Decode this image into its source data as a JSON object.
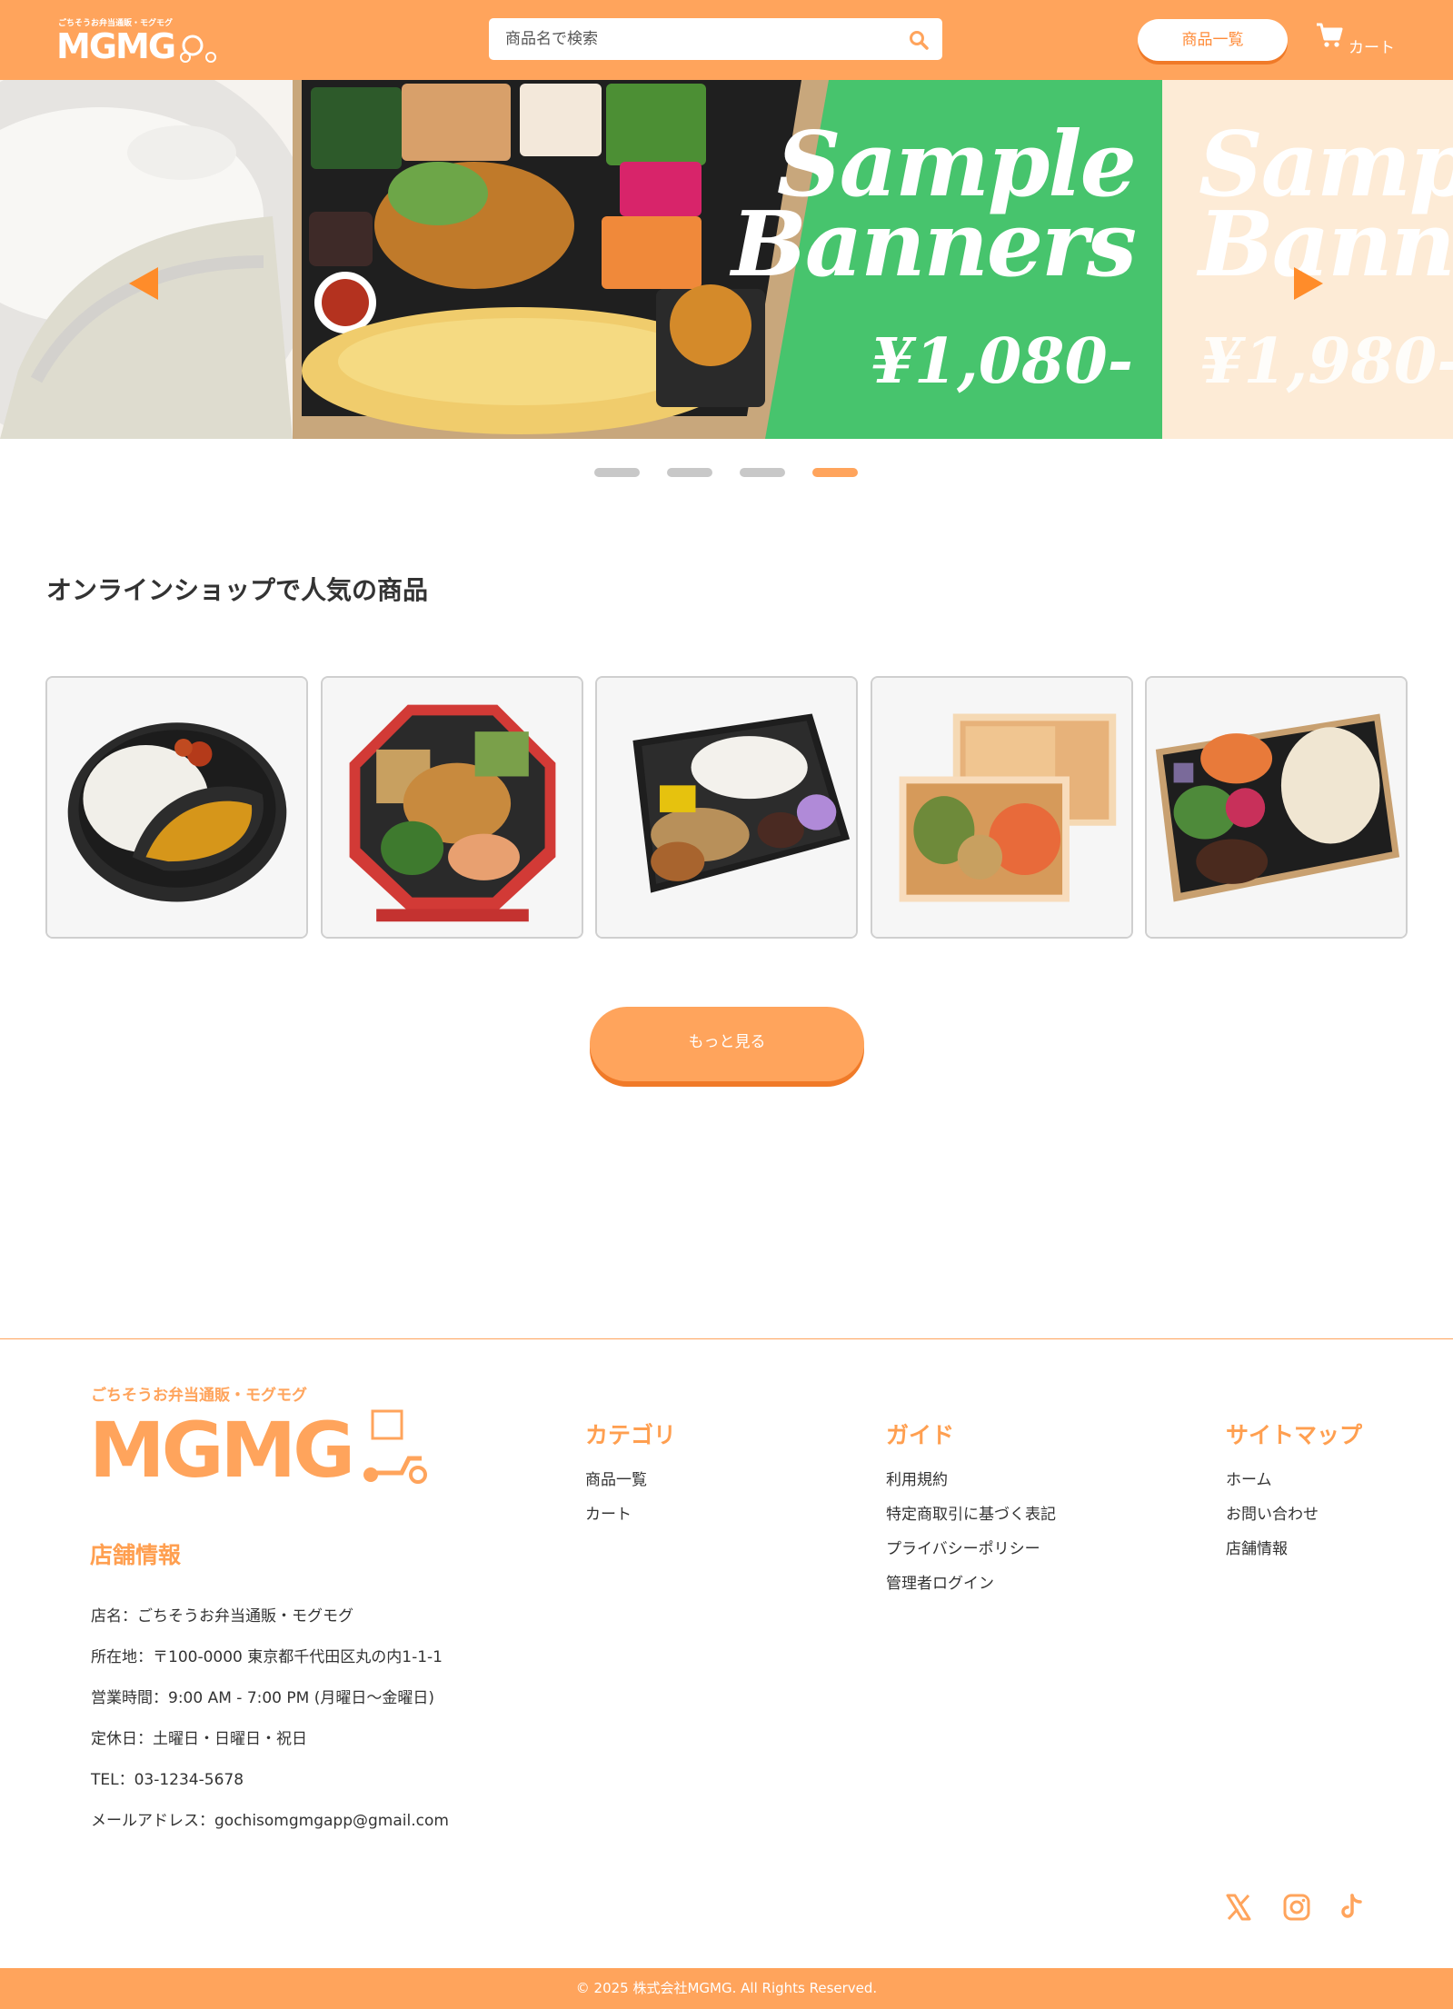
{
  "header": {
    "logo_tagline": "ごちそうお弁当通販・モグモグ",
    "logo_text": "MGMG",
    "search_placeholder": "商品名で検索",
    "products_button": "商品一覧",
    "cart_label": "カート",
    "icons": {
      "search": "search-icon",
      "cart": "cart-icon"
    }
  },
  "banner": {
    "main": {
      "title_line1": "Sample",
      "title_line2": "Banners",
      "price": "¥1,080-"
    },
    "next": {
      "title_line1": "Samp",
      "title_line2": "Banne",
      "price": "¥1,980-"
    },
    "slide_count": 4,
    "active_slide": 4
  },
  "popular": {
    "title": "オンラインショップで人気の商品",
    "products": [
      {
        "image": "curry-bento"
      },
      {
        "image": "octagon-bento"
      },
      {
        "image": "fish-bento"
      },
      {
        "image": "two-box-bento"
      },
      {
        "image": "rice-bento"
      }
    ],
    "more_button": "もっと見る"
  },
  "footer": {
    "logo_tagline": "ごちそうお弁当通販・モグモグ",
    "logo_text": "MGMG",
    "store": {
      "title": "店舗情報",
      "lines": [
        "店名：ごちそうお弁当通販・モグモグ",
        "所在地：〒100-0000 東京都千代田区丸の内1-1-1",
        "営業時間：9:00 AM - 7:00 PM (月曜日〜金曜日)",
        "定休日：土曜日・日曜日・祝日",
        "TEL：03-1234-5678",
        "メールアドレス：gochisomgmgapp@gmail.com"
      ]
    },
    "columns": [
      {
        "title": "カテゴリ",
        "links": [
          "商品一覧",
          "カート"
        ]
      },
      {
        "title": "ガイド",
        "links": [
          "利用規約",
          "特定商取引に基づく表記",
          "プライバシーポリシー",
          "管理者ログイン"
        ]
      },
      {
        "title": "サイトマップ",
        "links": [
          "ホーム",
          "お問い合わせ",
          "店舗情報"
        ]
      }
    ],
    "social": [
      "x-icon",
      "instagram-icon",
      "tiktok-icon"
    ],
    "copyright": "© 2025 株式会社MGMG. All Rights Reserved."
  },
  "colors": {
    "brand": "#ffa45c",
    "brand_dark": "#f07a28",
    "banner_green": "#47c46d",
    "banner_cream": "#fdebd6"
  }
}
